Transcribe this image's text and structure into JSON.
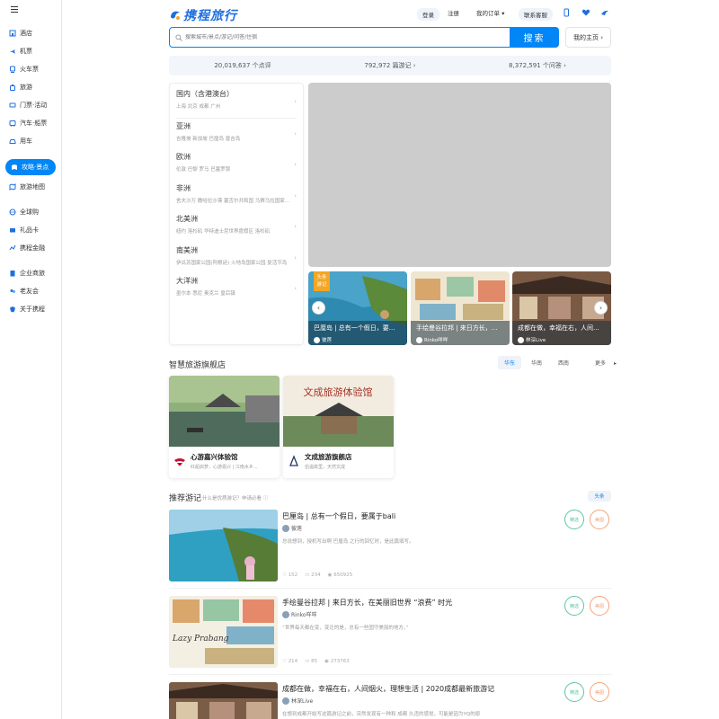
{
  "brand": {
    "name": "携程旅行",
    "accent": "#0086f6"
  },
  "sidebar": {
    "items": [
      {
        "label": "酒店",
        "icon": "hotel-icon"
      },
      {
        "label": "机票",
        "icon": "plane-icon"
      },
      {
        "label": "火车票",
        "icon": "train-icon"
      },
      {
        "label": "旅游",
        "icon": "travel-icon"
      },
      {
        "label": "门票·活动",
        "icon": "ticket-icon"
      },
      {
        "label": "汽车·船票",
        "icon": "bus-icon"
      },
      {
        "label": "用车",
        "icon": "car-icon"
      },
      {
        "label": "攻略·景点",
        "icon": "guide-icon",
        "active": true
      },
      {
        "label": "旅游地图",
        "icon": "map-icon"
      },
      {
        "label": "全球购",
        "icon": "globe-icon"
      },
      {
        "label": "礼品卡",
        "icon": "gift-card-icon"
      },
      {
        "label": "携程金融",
        "icon": "finance-icon"
      },
      {
        "label": "企业商旅",
        "icon": "business-icon"
      },
      {
        "label": "老友会",
        "icon": "club-icon"
      },
      {
        "label": "关于携程",
        "icon": "about-icon"
      }
    ]
  },
  "header": {
    "login": "登录",
    "register": "注册",
    "orders": "我的订单",
    "service": "联系客服"
  },
  "search": {
    "placeholder": "搜索城市/景点/游记/问答/住宿",
    "button": "搜索",
    "home": "我的主页"
  },
  "stats": {
    "reviews": "20,019,637 个点评",
    "notes": "792,972 篇游记",
    "questions": "8,372,591 个问答"
  },
  "regions": [
    {
      "title": "国内（含港澳台）",
      "sub": "上海  北京  成都  广州"
    },
    {
      "title": "亚洲",
      "sub": "吉隆坡  新加坡  巴厘岛  普吉岛"
    },
    {
      "title": "欧洲",
      "sub": "伦敦  巴黎  罗马  巴塞罗那"
    },
    {
      "title": "非洲",
      "sub": "舍夫沙万  撒哈拉沙漠  塞舌尔共和国  马赛马拉国家..."
    },
    {
      "title": "北美洲",
      "sub": "纽约  洛杉矶  华特迪士尼世界度假区  洛杉矶"
    },
    {
      "title": "南美洲",
      "sub": "伊瓜苏国家公园(阿根廷)  火地岛国家公园  复活节岛"
    },
    {
      "title": "大洋洲",
      "sub": "墨尔本  悉尼  奥克兰  皇后镇"
    }
  ],
  "cards": [
    {
      "title": "巴厘岛 | 总有一个假日，要...",
      "author": "彼莲",
      "badge": "头条\n游记"
    },
    {
      "title": "手绘曼谷拉邦 | 来日方长，...",
      "author": "Rinko咩咩"
    },
    {
      "title": "成都在做，幸福在右，人间...",
      "author": "林深Live"
    }
  ],
  "stores": {
    "title": "智慧旅游旗舰店",
    "tabs": [
      "华东",
      "华南",
      "西南",
      "更多"
    ],
    "items": [
      {
        "name": "心游嘉兴体验馆",
        "desc": "红船启梦，心游嘉兴 | 江南水乡..."
      },
      {
        "name": "文成旅游旗舰店",
        "desc": "伯温故里，天然文成",
        "sign": "文成旅游体验馆"
      }
    ]
  },
  "recommend": {
    "title": "推荐游记",
    "hint": "什么是优质游记？申请必看",
    "button": "头条",
    "stamp_green": "精选",
    "stamp_orange": "美图",
    "posts": [
      {
        "title": "巴厘岛 | 总有一个假日，要属于bali",
        "author": "彼莲",
        "desc": "总说想到，授机写出啊 巴厘岛 之行的回忆时，是此篇填写。",
        "likes": "152",
        "comments": "234",
        "views": "650925"
      },
      {
        "title": "手绘曼谷拉邦 | 来日方长，在美丽旧世界 “浪费” 时光",
        "author": "Rinko咩咩",
        "desc": "“世界每天都在变，变迁的是，总有一些固守美丽的地方。”",
        "likes": "214",
        "comments": "85",
        "views": "273763"
      },
      {
        "title": "成都在做，幸福在右，人间烟火，理想生活 | 2020成都最新旅游记",
        "author": "林深Live",
        "desc": "在想到成都开始写这篇游记之前，突然发现有一种和 成都 久违的感觉，可能是因为YQ的原"
      }
    ]
  },
  "thumb_text": {
    "lazy": "Lazy Prabang"
  }
}
